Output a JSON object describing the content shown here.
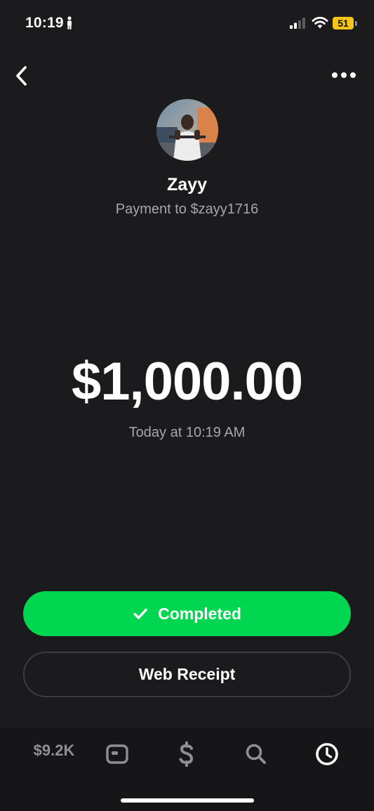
{
  "status_bar": {
    "time": "10:19",
    "battery_level": "51"
  },
  "recipient": {
    "name": "Zayy",
    "subtitle": "Payment to $zayy1716"
  },
  "payment": {
    "amount": "$1,000.00",
    "timestamp": "Today at 10:19 AM"
  },
  "actions": {
    "status_label": "Completed",
    "receipt_label": "Web Receipt"
  },
  "tab_bar": {
    "balance": "$9.2K",
    "tabs": [
      "card-icon",
      "dollar-icon",
      "search-icon",
      "activity-clock-icon"
    ],
    "active_tab": "activity-clock-icon"
  },
  "colors": {
    "background": "#1b1b1d",
    "accent_green": "#00d64f",
    "secondary_text": "#a7a7ab",
    "battery": "#f5c518"
  }
}
